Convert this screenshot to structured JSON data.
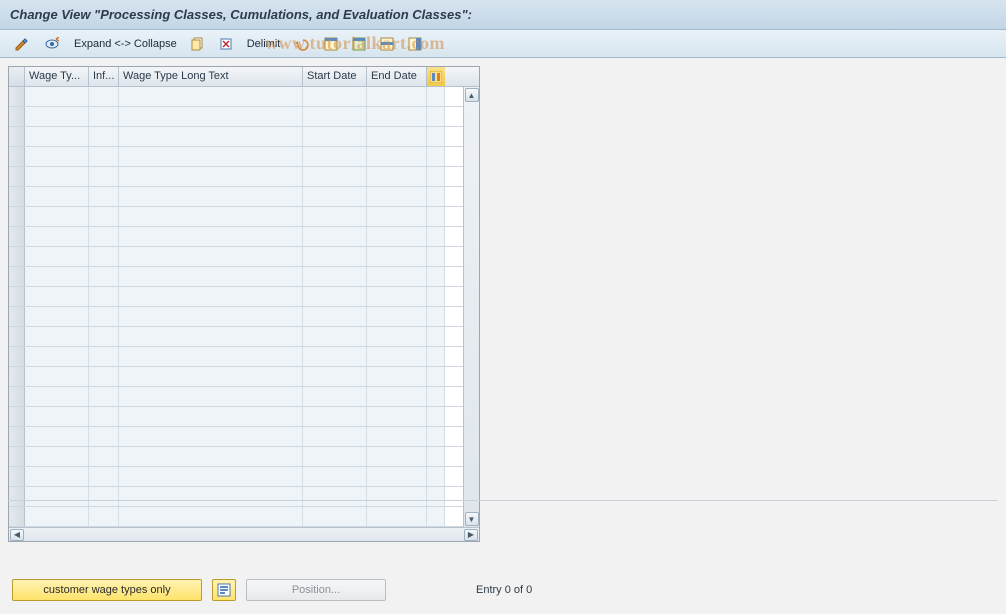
{
  "header": {
    "title": "Change View \"Processing Classes, Cumulations, and Evaluation Classes\":"
  },
  "toolbar": {
    "expand_label": "Expand <-> Collapse",
    "delimit_label": "Delimit"
  },
  "watermark": "www.tutorialkart.com",
  "table": {
    "columns": {
      "c1": "Wage Ty...",
      "c2": "Inf...",
      "c3": "Wage Type Long Text",
      "c4": "Start Date",
      "c5": "End Date"
    },
    "row_count": 22
  },
  "footer": {
    "customer_btn": "customer wage types only",
    "position_btn": "Position...",
    "entry_text": "Entry 0 of 0"
  }
}
